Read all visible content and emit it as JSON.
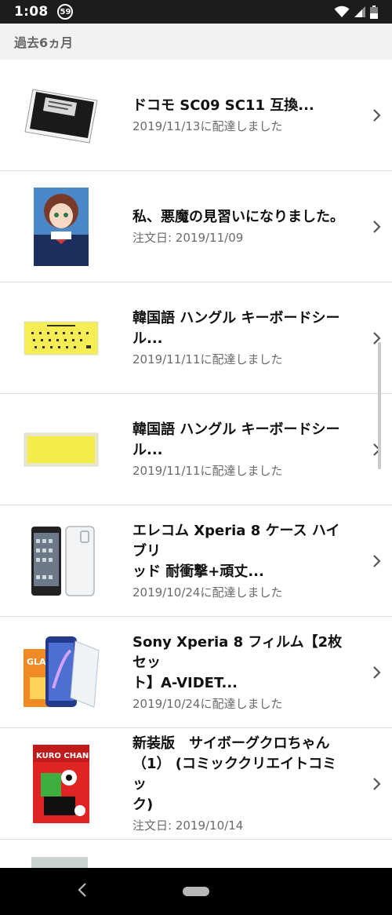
{
  "status_bar": {
    "time": "1:08",
    "badge": "59"
  },
  "section": {
    "title": "過去6ヵ月"
  },
  "orders": [
    {
      "title_lines": [
        "ドコモ SC09 SC11 互換..."
      ],
      "status": "2019/11/13に配達しました",
      "thumb": "battery"
    },
    {
      "title_lines": [
        "私、悪魔の見習いになりました。"
      ],
      "status": "注文日: 2019/11/09",
      "thumb": "book-anime"
    },
    {
      "title_lines": [
        "韓国語 ハングル キーボードシー",
        "ル..."
      ],
      "status": "2019/11/11に配達しました",
      "thumb": "sticker-printed"
    },
    {
      "title_lines": [
        "韓国語 ハングル キーボードシー",
        "ル..."
      ],
      "status": "2019/11/11に配達しました",
      "thumb": "sticker-plain"
    },
    {
      "title_lines": [
        "エレコム Xperia 8 ケース ハイブリ",
        "ッド 耐衝撃+頑丈..."
      ],
      "status": "2019/10/24に配達しました",
      "thumb": "phone-case"
    },
    {
      "title_lines": [
        "Sony Xperia 8 フィルム【2枚セッ",
        "ト】A-VIDET..."
      ],
      "status": "2019/10/24に配達しました",
      "thumb": "screen-film"
    },
    {
      "title_lines": [
        "新装版　サイボーグクロちゃん",
        "（1） (コミッククリエイトコミッ",
        "ク)"
      ],
      "status": "注文日: 2019/10/14",
      "thumb": "comic-cover"
    }
  ],
  "thumb_texts": {
    "glass_box": "GLAS",
    "comic_title": "KURO CHAN"
  }
}
